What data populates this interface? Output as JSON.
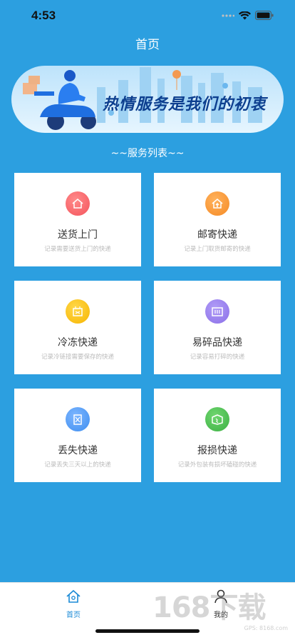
{
  "status": {
    "time": "4:53"
  },
  "nav": {
    "title": "首页"
  },
  "banner": {
    "slogan": "热情服务是我们的初衷"
  },
  "section": {
    "title": "~~服务列表~~"
  },
  "services": [
    {
      "title": "送货上门",
      "desc": "记录需要送货上门的快递",
      "icon": "house-icon",
      "color": "#f4545c"
    },
    {
      "title": "邮寄快递",
      "desc": "记录上门取货邮寄的快递",
      "icon": "house-upload-icon",
      "color": "#f58a25"
    },
    {
      "title": "冷冻快递",
      "desc": "记录冷链接需要保存的快递",
      "icon": "freezer-icon",
      "color": "#f7b500"
    },
    {
      "title": "易碎品快递",
      "desc": "记录容易打碎的快递",
      "icon": "fragile-box-icon",
      "color": "#8b6fe8"
    },
    {
      "title": "丢失快递",
      "desc": "记录丢失三天以上的快递",
      "icon": "lost-package-icon",
      "color": "#3e8ef0"
    },
    {
      "title": "报损快递",
      "desc": "记录外包装有损坏磕碰的快递",
      "icon": "damaged-package-icon",
      "color": "#3cb043"
    }
  ],
  "tabs": [
    {
      "label": "首页",
      "icon": "home-icon",
      "active": true
    },
    {
      "label": "我的",
      "icon": "person-icon",
      "active": false
    }
  ],
  "watermark": {
    "text": "168下载",
    "sub": "GPS: 8168.com"
  },
  "colors": {
    "background": "#2c9fe0",
    "accent": "#1a8ad6"
  }
}
